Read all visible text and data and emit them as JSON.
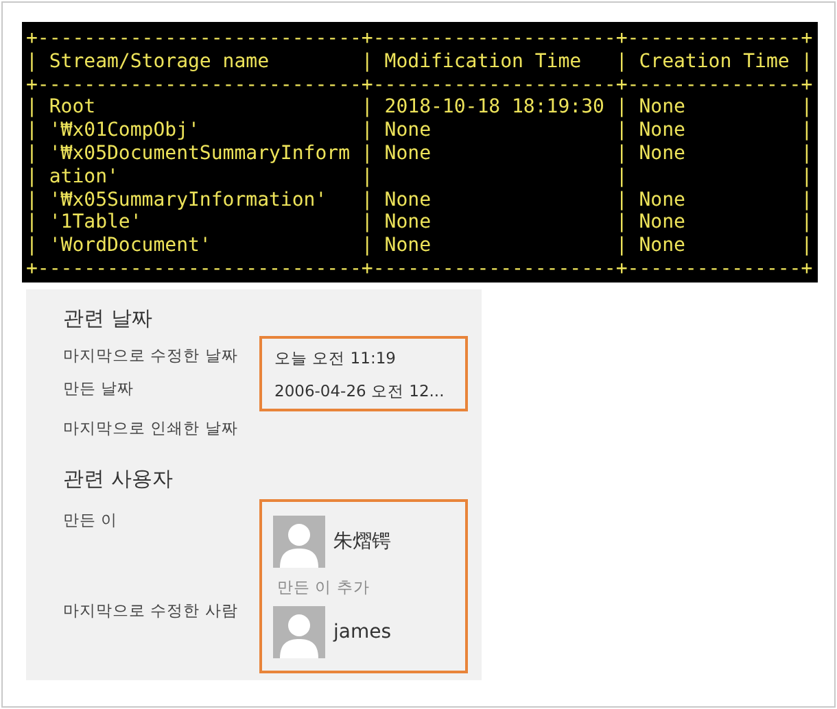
{
  "terminal": {
    "lines": [
      "+----------------------------+---------------------+---------------+",
      "| Stream/Storage name        | Modification Time   | Creation Time |",
      "+----------------------------+---------------------+---------------+",
      "| Root                       | 2018-10-18 18:19:30 | None          |",
      "| '₩x01CompObj'              | None                | None          |",
      "| '₩x05DocumentSummaryInform | None                | None          |",
      "| ation'                     |                     |               |",
      "| '₩x05SummaryInformation'   | None                | None          |",
      "| '1Table'                   | None                | None          |",
      "| 'WordDocument'             | None                | None          |",
      "+----------------------------+---------------------+---------------+"
    ]
  },
  "dates": {
    "title": "관련 날짜",
    "rows": [
      {
        "label": "마지막으로 수정한 날짜",
        "value": "오늘 오전 11:19"
      },
      {
        "label": "만든 날짜",
        "value": "2006-04-26 오전 12..."
      }
    ],
    "extra_labels": [
      "마지막으로 인쇄한 날짜"
    ]
  },
  "people": {
    "title": "관련 사용자",
    "rows": [
      {
        "label": "만든 이",
        "name": "朱熠锷",
        "add_link": "만든 이 추가"
      },
      {
        "label": "마지막으로 수정한 사람",
        "name": "james"
      }
    ]
  }
}
